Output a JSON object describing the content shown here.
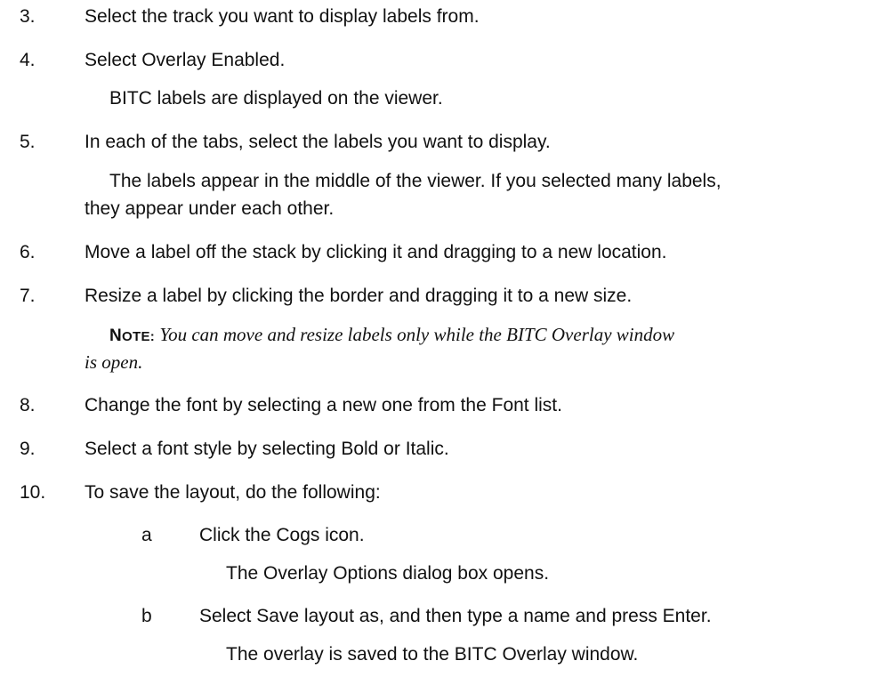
{
  "steps": [
    {
      "number": "3.",
      "text": "Select the track you want to display labels from."
    },
    {
      "number": "4.",
      "text": "Select Overlay Enabled.",
      "result": "BITC labels are displayed on the viewer."
    },
    {
      "number": "5.",
      "text": "In each of the tabs, select the labels you want to display.",
      "result_line1": "The labels appear in the middle of the viewer. If you selected many labels,",
      "result_line2": "they appear under each other."
    },
    {
      "number": "6.",
      "text": "Move a label off the stack by clicking it and dragging to a new location."
    },
    {
      "number": "7.",
      "text": "Resize a label by clicking the border and dragging it to a new size.",
      "note_label_first": "N",
      "note_label_rest": "OTE:",
      "note_line1": "You can move and resize labels only while the BITC Overlay window",
      "note_line2": "is open."
    },
    {
      "number": "8.",
      "text": "Change the font by selecting a new one from the Font list."
    },
    {
      "number": "9.",
      "text": "Select a font style by selecting Bold or Italic."
    },
    {
      "number": "10.",
      "text": "To save the layout, do the following:",
      "substeps": [
        {
          "letter": "a",
          "text": "Click the Cogs icon.",
          "result": "The Overlay Options dialog box opens."
        },
        {
          "letter": "b",
          "text": "Select Save layout as, and then type a name and press Enter.",
          "result": "The overlay is saved to the BITC Overlay window."
        }
      ]
    }
  ]
}
